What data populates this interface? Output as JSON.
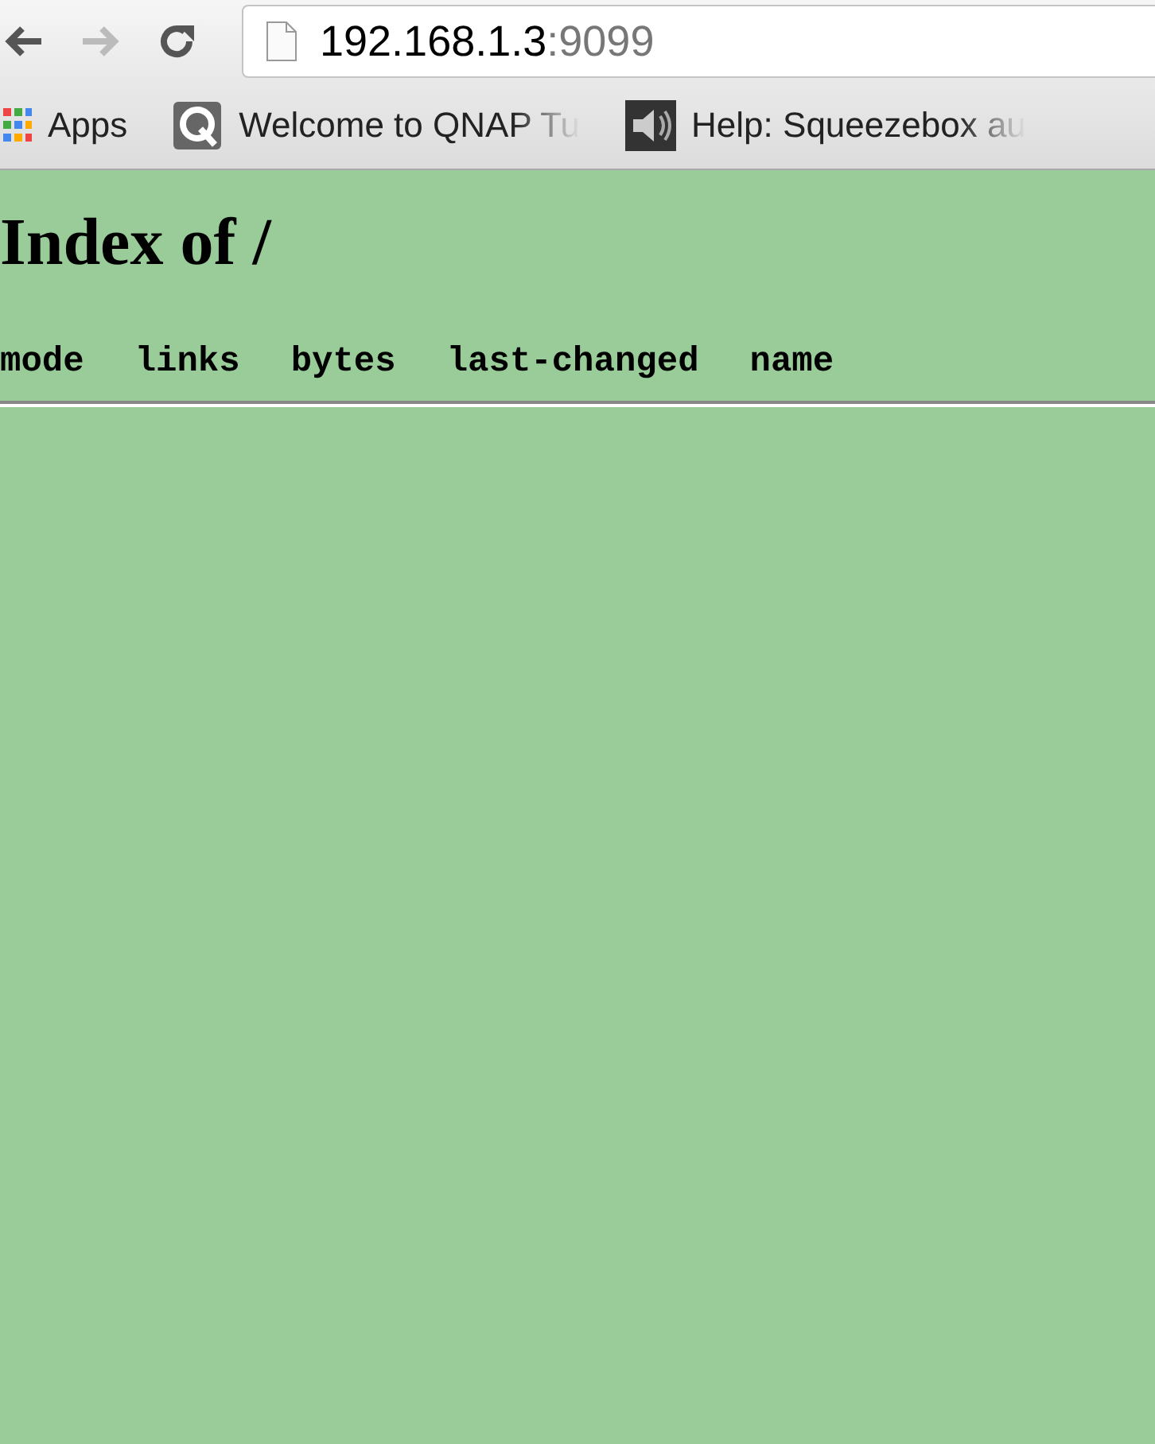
{
  "address_bar": {
    "host": "192.168.1.3",
    "port": ":9099"
  },
  "bookmarks": [
    {
      "label": "Apps",
      "kind": "apps"
    },
    {
      "label": "Welcome to QNAP Tu",
      "kind": "qnap"
    },
    {
      "label": "Help: Squeezebox au",
      "kind": "speaker"
    }
  ],
  "page": {
    "title": "Index of /",
    "columns": [
      "mode",
      "links",
      "bytes",
      "last-changed",
      "name"
    ]
  }
}
